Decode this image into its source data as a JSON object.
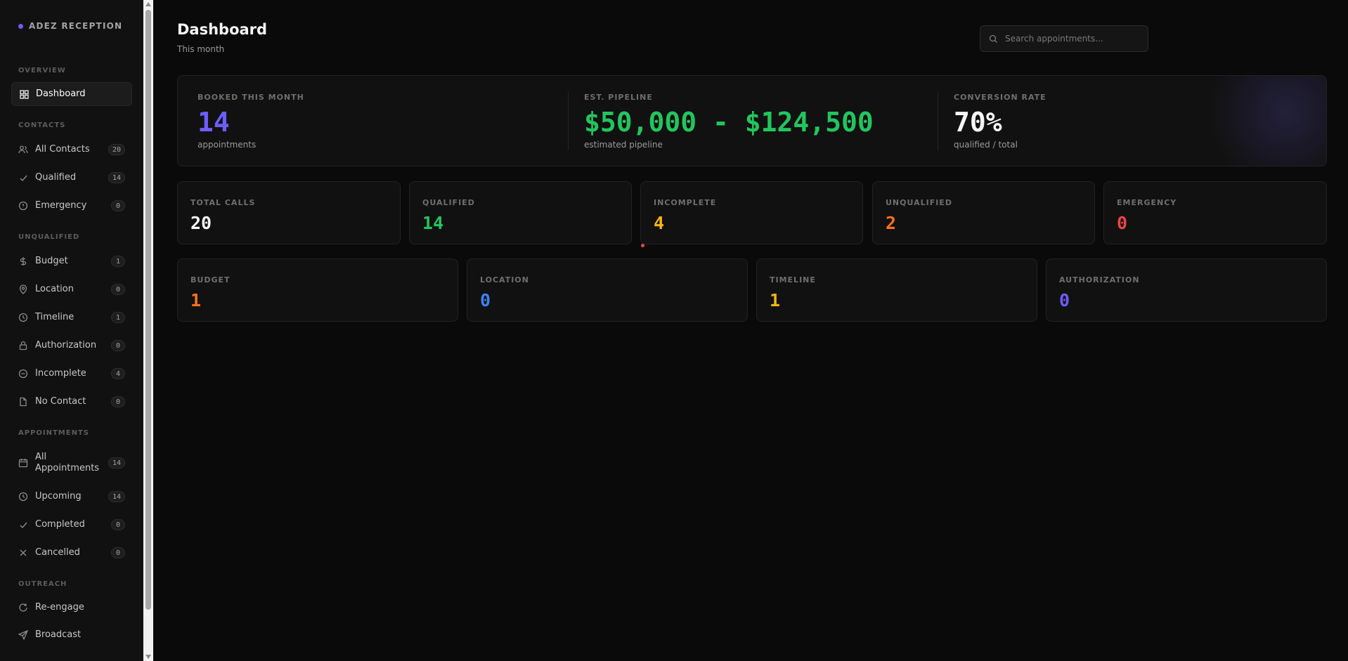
{
  "brand": {
    "name": "ADEZ RECEPTION"
  },
  "sidebar": {
    "sections": {
      "overview": "OVERVIEW",
      "contacts": "CONTACTS",
      "unqualified": "UNQUALIFIED",
      "appointments": "APPOINTMENTS",
      "outreach": "OUTREACH"
    },
    "items": {
      "dashboard": {
        "label": "Dashboard",
        "icon": "grid-icon",
        "active": true
      },
      "all_contacts": {
        "label": "All Contacts",
        "count": "20",
        "icon": "users-icon"
      },
      "qualified": {
        "label": "Qualified",
        "count": "14",
        "icon": "check-icon"
      },
      "emergency": {
        "label": "Emergency",
        "count": "0",
        "icon": "alert-circle-icon"
      },
      "budget": {
        "label": "Budget",
        "count": "1",
        "icon": "dollar-icon"
      },
      "location": {
        "label": "Location",
        "count": "0",
        "icon": "map-pin-icon"
      },
      "timeline": {
        "label": "Timeline",
        "count": "1",
        "icon": "clock-icon"
      },
      "authorization": {
        "label": "Authorization",
        "count": "0",
        "icon": "lock-icon"
      },
      "incomplete": {
        "label": "Incomplete",
        "count": "4",
        "icon": "minus-circle-icon"
      },
      "no_contact": {
        "label": "No Contact",
        "count": "0",
        "icon": "file-icon"
      },
      "all_appointments": {
        "label": "All Appointments",
        "count": "14",
        "icon": "calendar-icon"
      },
      "upcoming": {
        "label": "Upcoming",
        "count": "14",
        "icon": "clock-icon"
      },
      "completed": {
        "label": "Completed",
        "count": "0",
        "icon": "check-icon"
      },
      "cancelled": {
        "label": "Cancelled",
        "count": "0",
        "icon": "x-icon"
      },
      "reengage": {
        "label": "Re-engage",
        "icon": "refresh-icon"
      },
      "broadcast": {
        "label": "Broadcast",
        "icon": "send-icon"
      }
    }
  },
  "header": {
    "title": "Dashboard",
    "subtitle": "This month"
  },
  "search": {
    "placeholder": "Search appointments...",
    "value": ""
  },
  "hero": {
    "booked": {
      "label": "BOOKED THIS MONTH",
      "value": "14",
      "note": "appointments",
      "color": "#6d5dfc"
    },
    "pipeline": {
      "label": "EST. PIPELINE",
      "value": "$50,000 - $124,500",
      "note": "estimated pipeline",
      "color": "#22c55e"
    },
    "conversion": {
      "label": "CONVERSION RATE",
      "value": "70%",
      "note": "qualified / total",
      "color": "#f5f5f5"
    }
  },
  "stats_row1": {
    "total_calls": {
      "label": "TOTAL CALLS",
      "value": "20",
      "color": "#f5f5f5"
    },
    "qualified": {
      "label": "QUALIFIED",
      "value": "14",
      "color": "#22c55e"
    },
    "incomplete": {
      "label": "INCOMPLETE",
      "value": "4",
      "color": "#f5b50b"
    },
    "unqualified": {
      "label": "UNQUALIFIED",
      "value": "2",
      "color": "#f97316"
    },
    "emergency": {
      "label": "EMERGENCY",
      "value": "0",
      "color": "#ef4444"
    }
  },
  "stats_row2": {
    "budget": {
      "label": "BUDGET",
      "value": "1",
      "color": "#f97316"
    },
    "location": {
      "label": "LOCATION",
      "value": "0",
      "color": "#3b82f6"
    },
    "timeline": {
      "label": "TIMELINE",
      "value": "1",
      "color": "#f5b50b"
    },
    "authorization": {
      "label": "AUTHORIZATION",
      "value": "0",
      "color": "#6d5dfc"
    }
  }
}
